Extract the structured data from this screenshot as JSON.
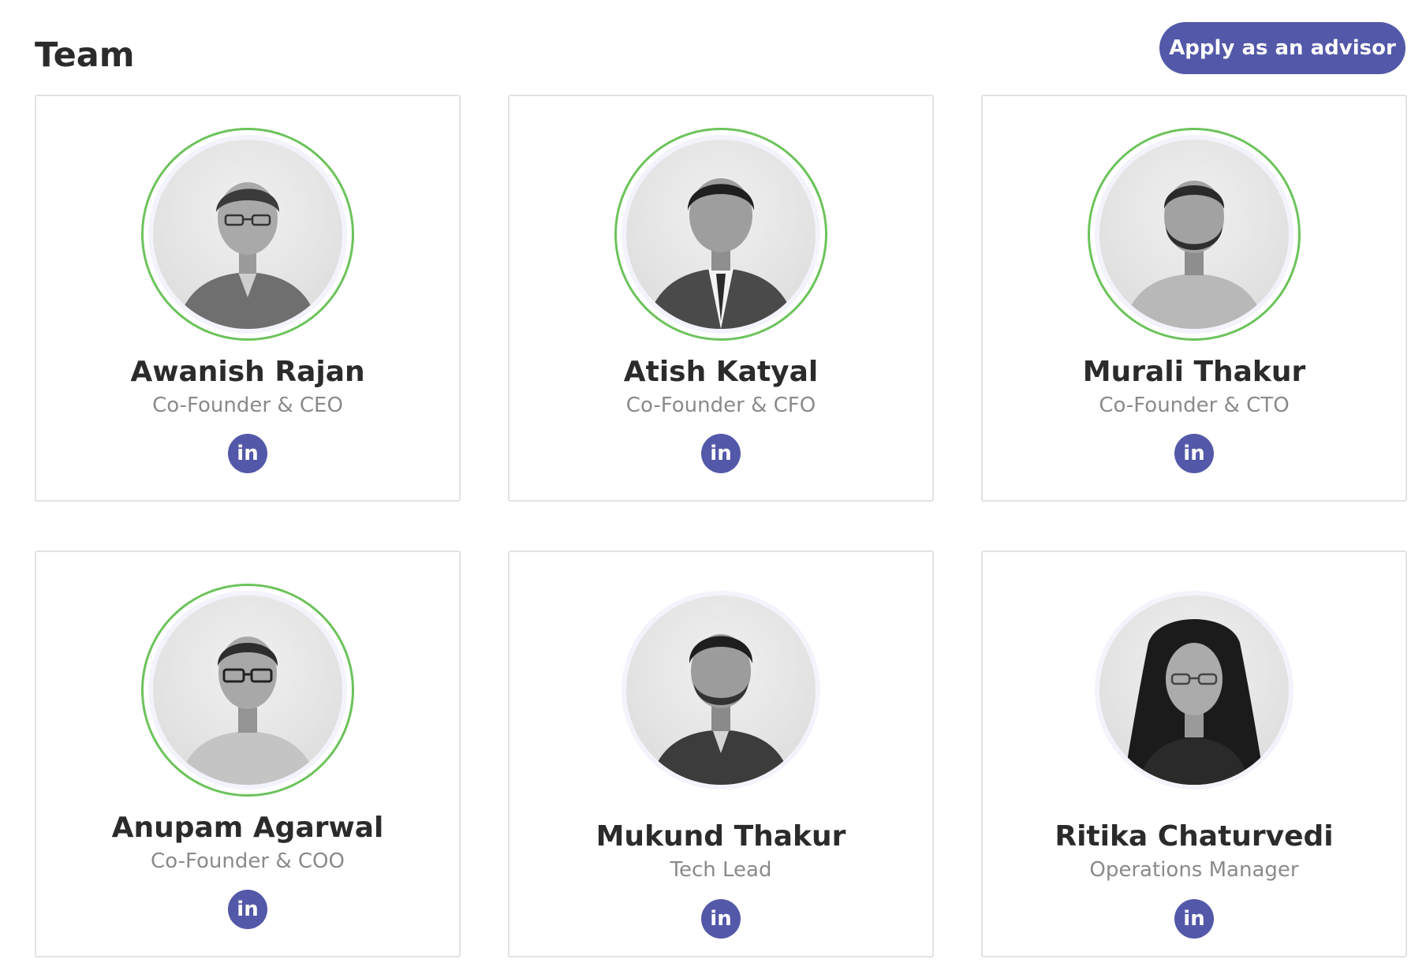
{
  "header": {
    "title": "Team",
    "advisor_button": "Apply as an advisor"
  },
  "colors": {
    "accent": "#5358a8",
    "ring": "#6cc35b",
    "card_border": "#e2e2e2",
    "role_text": "#8a8a8a"
  },
  "members": [
    {
      "name": "Awanish Rajan",
      "role": "Co-Founder & CEO",
      "social_icon": "linkedin-icon",
      "social_label": "in",
      "ring": true
    },
    {
      "name": "Atish Katyal",
      "role": "Co-Founder & CFO",
      "social_icon": "linkedin-icon",
      "social_label": "in",
      "ring": true
    },
    {
      "name": "Murali Thakur",
      "role": "Co-Founder & CTO",
      "social_icon": "linkedin-icon",
      "social_label": "in",
      "ring": true
    },
    {
      "name": "Anupam Agarwal",
      "role": "Co-Founder & COO",
      "social_icon": "linkedin-icon",
      "social_label": "in",
      "ring": true
    },
    {
      "name": "Mukund Thakur",
      "role": "Tech Lead",
      "social_icon": "linkedin-icon",
      "social_label": "in",
      "ring": false
    },
    {
      "name": "Ritika Chaturvedi",
      "role": "Operations Manager",
      "social_icon": "linkedin-icon",
      "social_label": "in",
      "ring": false
    }
  ]
}
